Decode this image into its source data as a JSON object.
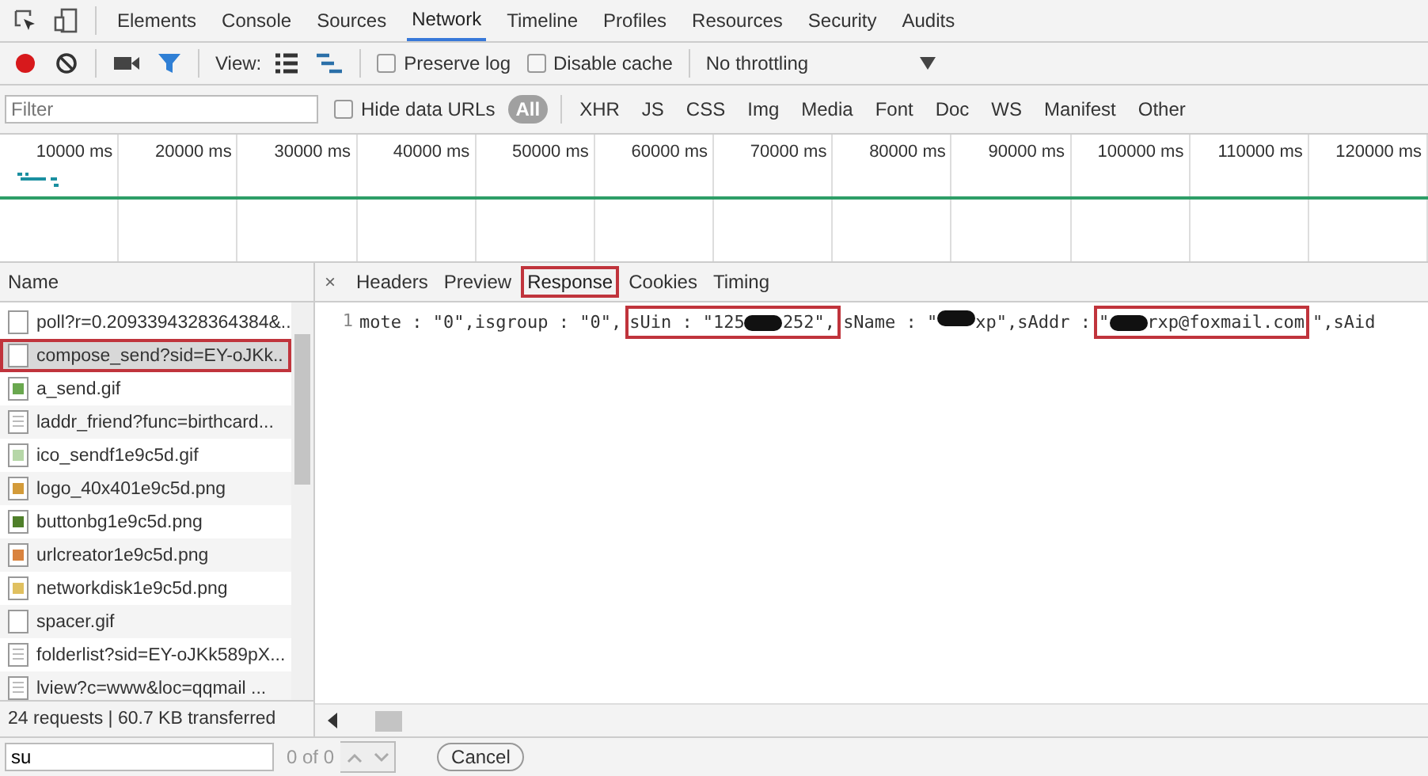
{
  "panel_tabs": [
    {
      "label": "Elements",
      "selected": false
    },
    {
      "label": "Console",
      "selected": false
    },
    {
      "label": "Sources",
      "selected": false
    },
    {
      "label": "Network",
      "selected": true
    },
    {
      "label": "Timeline",
      "selected": false
    },
    {
      "label": "Profiles",
      "selected": false
    },
    {
      "label": "Resources",
      "selected": false
    },
    {
      "label": "Security",
      "selected": false
    },
    {
      "label": "Audits",
      "selected": false
    }
  ],
  "toolbar": {
    "recording": true,
    "filter_on": true,
    "view_label": "View:",
    "preserve_log": {
      "label": "Preserve log",
      "checked": false
    },
    "disable_cache": {
      "label": "Disable cache",
      "checked": false
    },
    "throttling": "No throttling"
  },
  "filter_bar": {
    "placeholder": "Filter",
    "hide_data_urls": {
      "label": "Hide data URLs",
      "checked": false
    },
    "types": [
      {
        "label": "All",
        "selected": true
      },
      {
        "label": "XHR",
        "selected": false
      },
      {
        "label": "JS",
        "selected": false
      },
      {
        "label": "CSS",
        "selected": false
      },
      {
        "label": "Img",
        "selected": false
      },
      {
        "label": "Media",
        "selected": false
      },
      {
        "label": "Font",
        "selected": false
      },
      {
        "label": "Doc",
        "selected": false
      },
      {
        "label": "WS",
        "selected": false
      },
      {
        "label": "Manifest",
        "selected": false
      },
      {
        "label": "Other",
        "selected": false
      }
    ]
  },
  "timeline": {
    "ticks": [
      "10000 ms",
      "20000 ms",
      "30000 ms",
      "40000 ms",
      "50000 ms",
      "60000 ms",
      "70000 ms",
      "80000 ms",
      "90000 ms",
      "100000 ms",
      "110000 ms",
      "120000 ms"
    ]
  },
  "requests": {
    "column": "Name",
    "rows": [
      {
        "name": "poll?r=0.2093394328364384&..",
        "kind": "blank",
        "selected": false,
        "annotated": false
      },
      {
        "name": "compose_send?sid=EY-oJKk..",
        "kind": "blank",
        "selected": true,
        "annotated": true
      },
      {
        "name": "a_send.gif",
        "kind": "image",
        "color": "#6aa84f",
        "selected": false,
        "annotated": false
      },
      {
        "name": "laddr_friend?func=birthcard...",
        "kind": "doc",
        "selected": false,
        "annotated": false
      },
      {
        "name": "ico_sendf1e9c5d.gif",
        "kind": "image",
        "color": "#b6d7a8",
        "selected": false,
        "annotated": false
      },
      {
        "name": "logo_40x401e9c5d.png",
        "kind": "image",
        "color": "#d39b3a",
        "selected": false,
        "annotated": false
      },
      {
        "name": "buttonbg1e9c5d.png",
        "kind": "image",
        "color": "#4f7f2a",
        "selected": false,
        "annotated": false
      },
      {
        "name": "urlcreator1e9c5d.png",
        "kind": "image",
        "color": "#d9833f",
        "selected": false,
        "annotated": false
      },
      {
        "name": "networkdisk1e9c5d.png",
        "kind": "image",
        "color": "#e0c060",
        "selected": false,
        "annotated": false
      },
      {
        "name": "spacer.gif",
        "kind": "blank",
        "selected": false,
        "annotated": false
      },
      {
        "name": "folderlist?sid=EY-oJKk589pX...",
        "kind": "doc",
        "selected": false,
        "annotated": false
      },
      {
        "name": "lview?c=www&loc=qqmail ...",
        "kind": "doc",
        "selected": false,
        "annotated": false
      }
    ],
    "summary": "24 requests | 60.7 KB transferred"
  },
  "detail": {
    "close": "×",
    "tabs": [
      {
        "label": "Headers",
        "selected": false,
        "annotated": false
      },
      {
        "label": "Preview",
        "selected": false,
        "annotated": false
      },
      {
        "label": "Response",
        "selected": true,
        "annotated": true
      },
      {
        "label": "Cookies",
        "selected": false,
        "annotated": false
      },
      {
        "label": "Timing",
        "selected": false,
        "annotated": false
      }
    ],
    "line_number": "1",
    "code_parts": [
      {
        "kind": "plain",
        "pieces": [
          {
            "kind": "text",
            "text": "mote : \"0\",isgroup : \"0\","
          }
        ]
      },
      {
        "kind": "framed",
        "pieces": [
          {
            "kind": "text",
            "text": "sUin : \"125"
          },
          {
            "kind": "redacted"
          },
          {
            "kind": "text",
            "text": "252\","
          }
        ]
      },
      {
        "kind": "plain",
        "pieces": [
          {
            "kind": "text",
            "text": "sName : \""
          },
          {
            "kind": "redacted"
          },
          {
            "kind": "text",
            "text": "xp\",sAddr : "
          }
        ]
      },
      {
        "kind": "framed",
        "pieces": [
          {
            "kind": "text",
            "text": "\""
          },
          {
            "kind": "redacted"
          },
          {
            "kind": "text",
            "text": "rxp@foxmail.com"
          }
        ]
      },
      {
        "kind": "plain",
        "pieces": [
          {
            "kind": "text",
            "text": "\",sAid"
          }
        ]
      }
    ]
  },
  "search": {
    "value": "su",
    "count": "0 of 0",
    "cancel": "Cancel"
  }
}
